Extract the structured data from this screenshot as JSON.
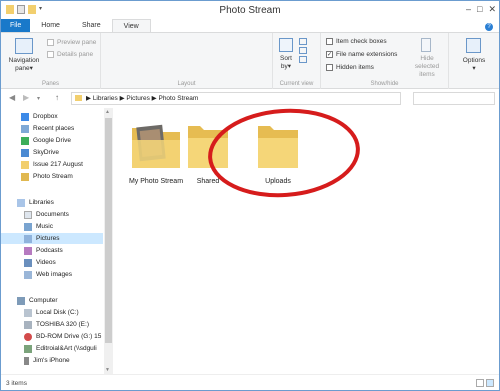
{
  "window": {
    "title": "Photo Stream"
  },
  "ribbon_tabs": [
    "File",
    "Home",
    "Share",
    "View"
  ],
  "ribbon": {
    "panes": {
      "navigation_pane": "Navigation pane",
      "preview_pane": "Preview pane",
      "details_pane": "Details pane",
      "group_label": "Panes"
    },
    "layout": {
      "group_label": "Layout"
    },
    "current_view": {
      "sort_by": "Sort by",
      "group_label": "Current view"
    },
    "show_hide": {
      "item_check_boxes": {
        "label": "Item check boxes",
        "checked": false
      },
      "file_name_extensions": {
        "label": "File name extensions",
        "checked": true
      },
      "hidden_items": {
        "label": "Hidden items",
        "checked": false
      },
      "hide_selected_items": "Hide selected items",
      "group_label": "Show/hide"
    },
    "options": "Options"
  },
  "address_bar": {
    "breadcrumbs": [
      "Libraries",
      "Pictures",
      "Photo Stream"
    ],
    "separator": "▶"
  },
  "nav_pane": {
    "favorites": [
      "Dropbox",
      "Recent places",
      "Google Drive",
      "SkyDrive",
      "Issue 217 August",
      "Photo Stream"
    ],
    "libraries_header": "Libraries",
    "libraries": [
      "Documents",
      "Music",
      "Pictures",
      "Podcasts",
      "Videos",
      "Web images"
    ],
    "selected": "Pictures",
    "computer_header": "Computer",
    "computer": [
      "Local Disk (C:)",
      "TOSHIBA 320 (E:)",
      "BD-ROM Drive (G:) 15",
      "Editroial&Art (\\\\sdguli",
      "Jim's iPhone"
    ]
  },
  "content": {
    "folders": [
      "My Photo Stream",
      "Shared",
      "Uploads"
    ]
  },
  "status_bar": {
    "item_count": "3 items"
  },
  "colors": {
    "file_tab": "#1979ca",
    "selection": "#cce8ff",
    "folder": "#f2cf6e",
    "annotation_circle": "#d61c1c"
  }
}
